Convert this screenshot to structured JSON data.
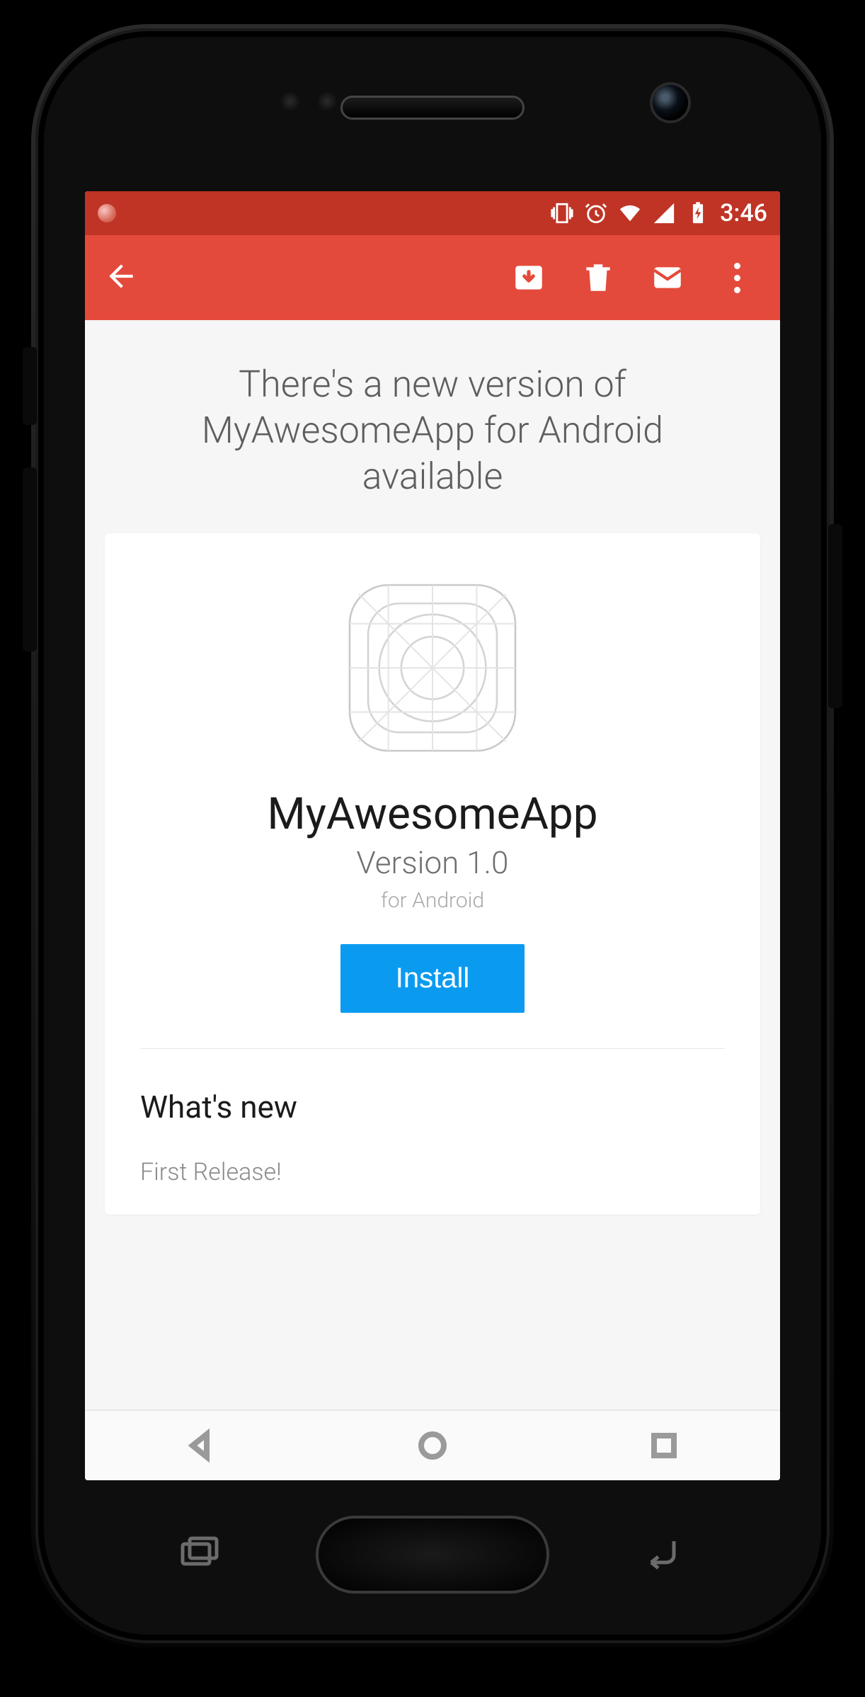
{
  "status_bar": {
    "time": "3:46",
    "icons": {
      "vibrate": "vibrate-icon",
      "alarm": "alarm-icon",
      "wifi": "wifi-icon",
      "signal": "cellular-signal-icon",
      "battery": "battery-charging-icon"
    }
  },
  "app_bar": {
    "back": "back-icon",
    "actions": {
      "archive": "archive-icon",
      "delete": "delete-icon",
      "mark_unread": "mail-icon",
      "overflow": "more-icon"
    }
  },
  "email": {
    "subject": "There's a new version of MyAwesomeApp for Android available",
    "card": {
      "app_icon": "app-icon-template",
      "app_name": "MyAwesomeApp",
      "version": "Version 1.0",
      "platform": "for Android",
      "install_label": "Install",
      "whats_new_heading": "What's new",
      "release_notes": "First Release!"
    }
  },
  "soft_nav": {
    "back": "nav-back-icon",
    "home": "nav-home-icon",
    "recents": "nav-recents-icon"
  },
  "colors": {
    "status_bar_bg": "#bf3425",
    "app_bar_bg": "#e44a3b",
    "install_button_bg": "#0a9bf1"
  }
}
